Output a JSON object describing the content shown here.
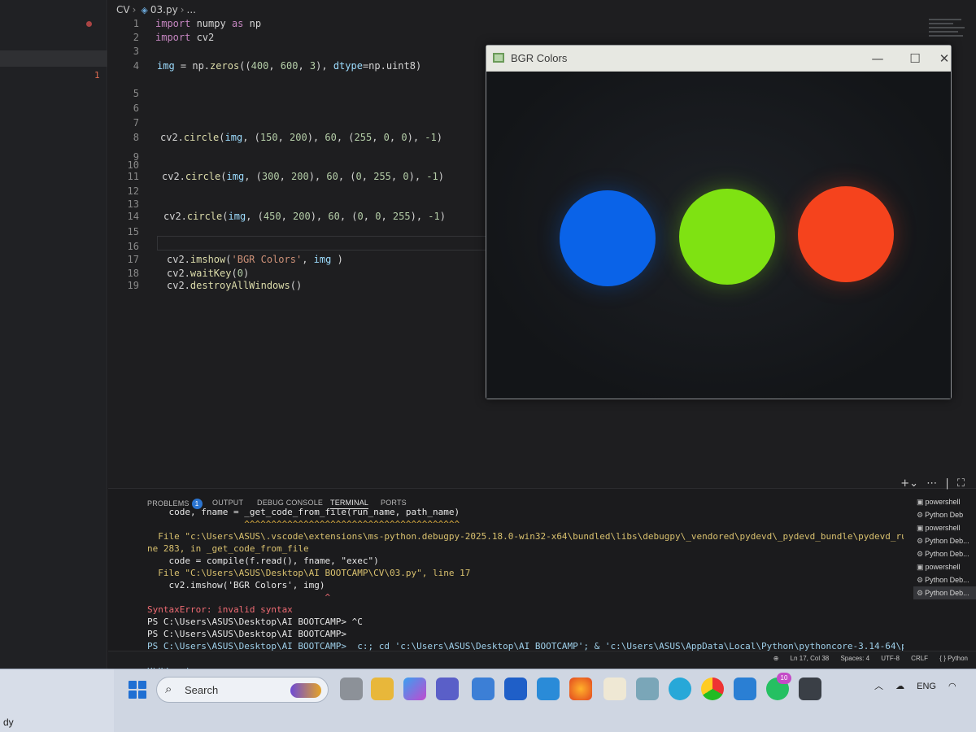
{
  "breadcrumb": {
    "folder": "CV",
    "file": "03.py",
    "rest": "..."
  },
  "sidebar": {
    "problem_count": "1"
  },
  "code_lines": [
    {
      "n": "1",
      "text": "import numpy as np"
    },
    {
      "n": "2",
      "text": "import cv2"
    },
    {
      "n": "3",
      "text": ""
    },
    {
      "n": "4",
      "text": "img = np.zeros((400, 600, 3), dtype=np.uint8)"
    },
    {
      "n": "5",
      "text": ""
    },
    {
      "n": "6",
      "text": ""
    },
    {
      "n": "7",
      "text": ""
    },
    {
      "n": "8",
      "text": "cv2.circle(img, (150, 200), 60, (255, 0, 0), -1)"
    },
    {
      "n": "9",
      "text": ""
    },
    {
      "n": "10",
      "text": ""
    },
    {
      "n": "11",
      "text": "cv2.circle(img, (300, 200), 60, (0, 255, 0), -1)"
    },
    {
      "n": "12",
      "text": ""
    },
    {
      "n": "13",
      "text": ""
    },
    {
      "n": "14",
      "text": "cv2.circle(img, (450, 200), 60, (0, 0, 255), -1)"
    },
    {
      "n": "15",
      "text": ""
    },
    {
      "n": "16",
      "text": ""
    },
    {
      "n": "17",
      "text": "cv2.imshow('BGR Colors', img )"
    },
    {
      "n": "18",
      "text": "cv2.waitKey(0)"
    },
    {
      "n": "19",
      "text": "cv2.destroyAllWindows()"
    }
  ],
  "cv_window": {
    "title": "BGR Colors",
    "circles": [
      {
        "name": "blue-circle",
        "color": "#0a63e8"
      },
      {
        "name": "green-circle",
        "color": "#7fe212"
      },
      {
        "name": "red-circle",
        "color": "#f5431d"
      }
    ]
  },
  "panel": {
    "tabs": [
      "PROBLEMS",
      "OUTPUT",
      "DEBUG CONSOLE",
      "TERMINAL",
      "PORTS"
    ],
    "problems_badge": "1",
    "active_tab": "TERMINAL",
    "terminal_lines": [
      {
        "cls": "t-cmd",
        "text": "    code, fname = _get_code_from_file(run_name, path_name)"
      },
      {
        "cls": "t-squig",
        "text": "                  ^^^^^^^^^^^^^^^^^^^^^^^^^^^^^^^^^^^^^^^^"
      },
      {
        "cls": "t-path",
        "text": "  File \"c:\\Users\\ASUS\\.vscode\\extensions\\ms-python.debugpy-2025.18.0-win32-x64\\bundled\\libs\\debugpy\\_vendored\\pydevd\\_pydevd_bundle\\pydevd_runpy.py\", li"
      },
      {
        "cls": "t-path",
        "text": "ne 283, in _get_code_from_file"
      },
      {
        "cls": "t-cmd",
        "text": "    code = compile(f.read(), fname, \"exec\")"
      },
      {
        "cls": "t-path",
        "text": "  File \"C:\\Users\\ASUS\\Desktop\\AI BOOTCAMP\\CV\\03.py\", line 17"
      },
      {
        "cls": "t-cmd",
        "text": "    cv2.imshow('BGR Colors', img)"
      },
      {
        "cls": "t-red",
        "text": "                                 ^"
      },
      {
        "cls": "t-red",
        "text": "SyntaxError: invalid syntax"
      },
      {
        "cls": "t-cmd",
        "text": "PS C:\\Users\\ASUS\\Desktop\\AI BOOTCAMP> ^C"
      },
      {
        "cls": "t-cmd",
        "text": "PS C:\\Users\\ASUS\\Desktop\\AI BOOTCAMP>"
      },
      {
        "cls": "t-strp",
        "text": "PS C:\\Users\\ASUS\\Desktop\\AI BOOTCAMP>  c:; cd 'c:\\Users\\ASUS\\Desktop\\AI BOOTCAMP'; & 'c:\\Users\\ASUS\\AppData\\Local\\Python\\pythoncore-3.14-64\\python.exe'"
      },
      {
        "cls": "t-strp",
        "text": " 'c:\\Users\\ASUS\\.vscode\\extensions\\ms-python.debugpy-2025.18.0-win32-x64\\bundled\\libs\\debugpy\\launcher' '57446' '--' 'C:\\Users\\ASUS\\Desktop\\AI BOOTCAMP\\C"
      },
      {
        "cls": "t-strp",
        "text": "V\\03.py'"
      }
    ],
    "terminal_list": [
      {
        "label": "powershell",
        "icon": "terminal-icon"
      },
      {
        "label": "Python Deb",
        "icon": "debug-icon"
      },
      {
        "label": "powershell",
        "icon": "terminal-icon"
      },
      {
        "label": "Python Deb...",
        "icon": "debug-icon"
      },
      {
        "label": "Python Deb...",
        "icon": "debug-icon"
      },
      {
        "label": "powershell",
        "icon": "terminal-icon"
      },
      {
        "label": "Python Deb...",
        "icon": "debug-icon"
      },
      {
        "label": "Python Deb...",
        "icon": "debug-icon",
        "selected": true
      }
    ]
  },
  "status": {
    "position": "Ln 17, Col 38",
    "spaces": "Spaces: 4",
    "encoding": "UTF-8",
    "eol": "CRLF",
    "language": "{ } Python"
  },
  "taskbar": {
    "left_text": "dy",
    "search_label": "Search",
    "whatsapp_badge": "10",
    "lang": "ENG"
  }
}
